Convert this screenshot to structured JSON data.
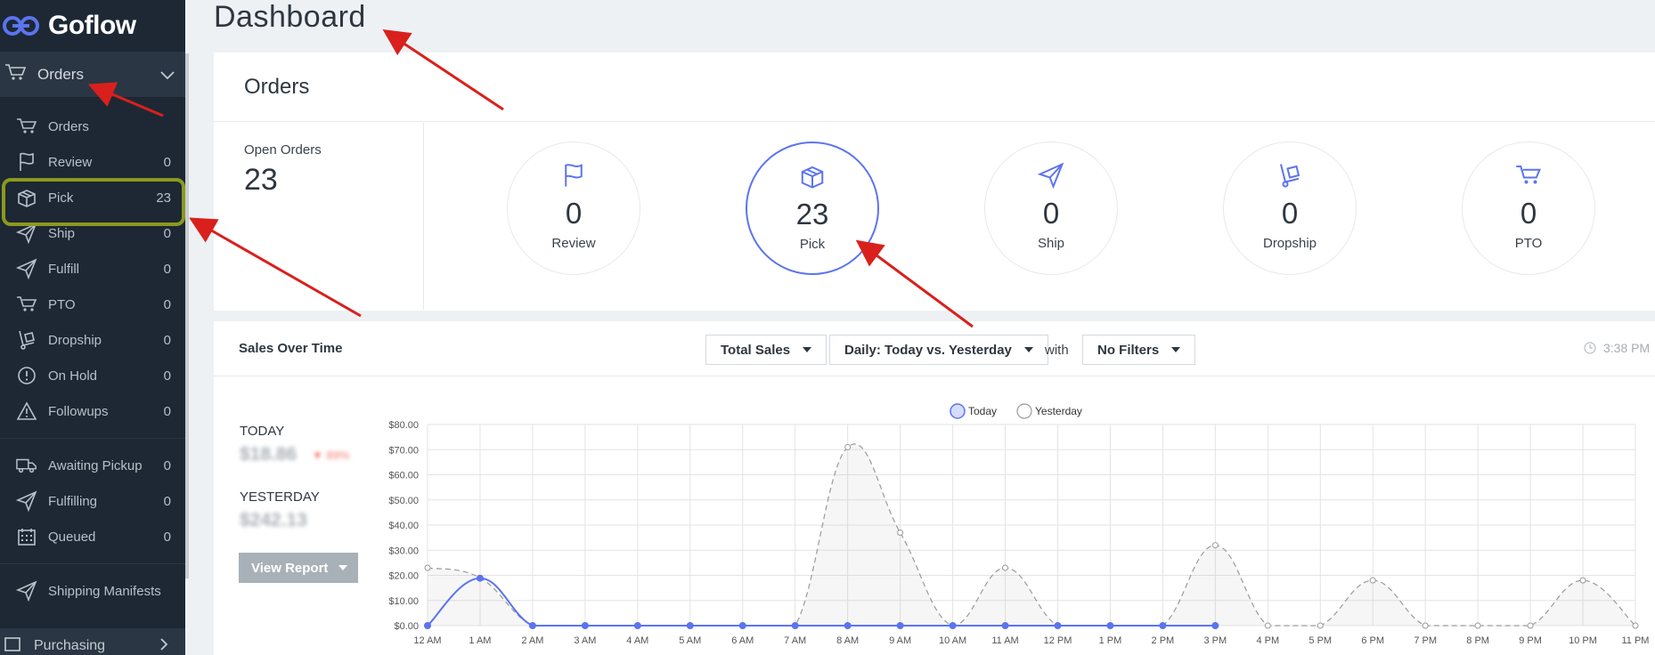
{
  "app": {
    "logo_text": "Goflow"
  },
  "sidebar": {
    "section_label": "Orders",
    "items": [
      {
        "label": "Orders",
        "count": "",
        "icon": "cart-icon"
      },
      {
        "label": "Review",
        "count": "0",
        "icon": "flag-icon"
      },
      {
        "label": "Pick",
        "count": "23",
        "icon": "box-icon"
      },
      {
        "label": "Ship",
        "count": "0",
        "icon": "paper-plane-icon"
      },
      {
        "label": "Fulfill",
        "count": "0",
        "icon": "paper-plane-icon"
      },
      {
        "label": "PTO",
        "count": "0",
        "icon": "cart-icon"
      },
      {
        "label": "Dropship",
        "count": "0",
        "icon": "hand-truck-icon"
      },
      {
        "label": "On Hold",
        "count": "0",
        "icon": "alert-circle-icon"
      },
      {
        "label": "Followups",
        "count": "0",
        "icon": "warning-triangle-icon"
      }
    ],
    "items2": [
      {
        "label": "Awaiting Pickup",
        "count": "0",
        "icon": "truck-icon"
      },
      {
        "label": "Fulfilling",
        "count": "0",
        "icon": "paper-plane-icon"
      },
      {
        "label": "Queued",
        "count": "0",
        "icon": "calendar-icon"
      }
    ],
    "items3": [
      {
        "label": "Shipping Manifests",
        "count": "",
        "icon": "paper-plane-icon"
      }
    ],
    "purchasing_label": "Purchasing"
  },
  "page": {
    "title": "Dashboard"
  },
  "orders_card": {
    "title": "Orders",
    "open_orders_label": "Open Orders",
    "open_orders_value": "23",
    "stats": [
      {
        "label": "Review",
        "value": "0",
        "icon": "flag-icon"
      },
      {
        "label": "Pick",
        "value": "23",
        "icon": "box-icon"
      },
      {
        "label": "Ship",
        "value": "0",
        "icon": "paper-plane-icon"
      },
      {
        "label": "Dropship",
        "value": "0",
        "icon": "hand-truck-icon"
      },
      {
        "label": "PTO",
        "value": "0",
        "icon": "cart-icon"
      }
    ]
  },
  "sales_card": {
    "title": "Sales Over Time",
    "metric_select": "Total Sales",
    "period_select": "Daily: Today vs. Yesterday",
    "with_label": "with",
    "filter_select": "No Filters",
    "time": "3:38 PM",
    "today_label": "TODAY",
    "today_value": "$18.86",
    "today_change": "▼ 89%",
    "yesterday_label": "YESTERDAY",
    "yesterday_value": "$242.13",
    "view_report_label": "View Report"
  },
  "colors": {
    "accent": "#5b74ef",
    "sidebar_bg": "#1d2834",
    "highlight": "#8b9a1e",
    "annotation_arrow": "#d9201d"
  },
  "chart_data": {
    "type": "line",
    "categories": [
      "12 AM",
      "1 AM",
      "2 AM",
      "3 AM",
      "4 AM",
      "5 AM",
      "6 AM",
      "7 AM",
      "8 AM",
      "9 AM",
      "10 AM",
      "11 AM",
      "12 PM",
      "1 PM",
      "2 PM",
      "3 PM",
      "4 PM",
      "5 PM",
      "6 PM",
      "7 PM",
      "8 PM",
      "9 PM",
      "10 PM",
      "11 PM"
    ],
    "y_ticks": [
      "$0.00",
      "$10.00",
      "$20.00",
      "$30.00",
      "$40.00",
      "$50.00",
      "$60.00",
      "$70.00",
      "$80.00"
    ],
    "ylim": [
      0,
      80
    ],
    "grid": true,
    "legend_position": "top-center",
    "series": [
      {
        "name": "Today",
        "color": "#5b74ef",
        "values": [
          0,
          18.86,
          0,
          0,
          0,
          0,
          0,
          0,
          0,
          0,
          0,
          0,
          0,
          0,
          0,
          0
        ]
      },
      {
        "name": "Yesterday",
        "color": "#999999",
        "values": [
          23,
          19,
          0,
          0,
          0,
          0,
          0,
          0,
          71,
          37,
          0,
          23,
          0,
          0,
          0,
          32,
          0,
          0,
          18,
          0,
          0,
          0,
          18,
          0
        ]
      }
    ]
  }
}
